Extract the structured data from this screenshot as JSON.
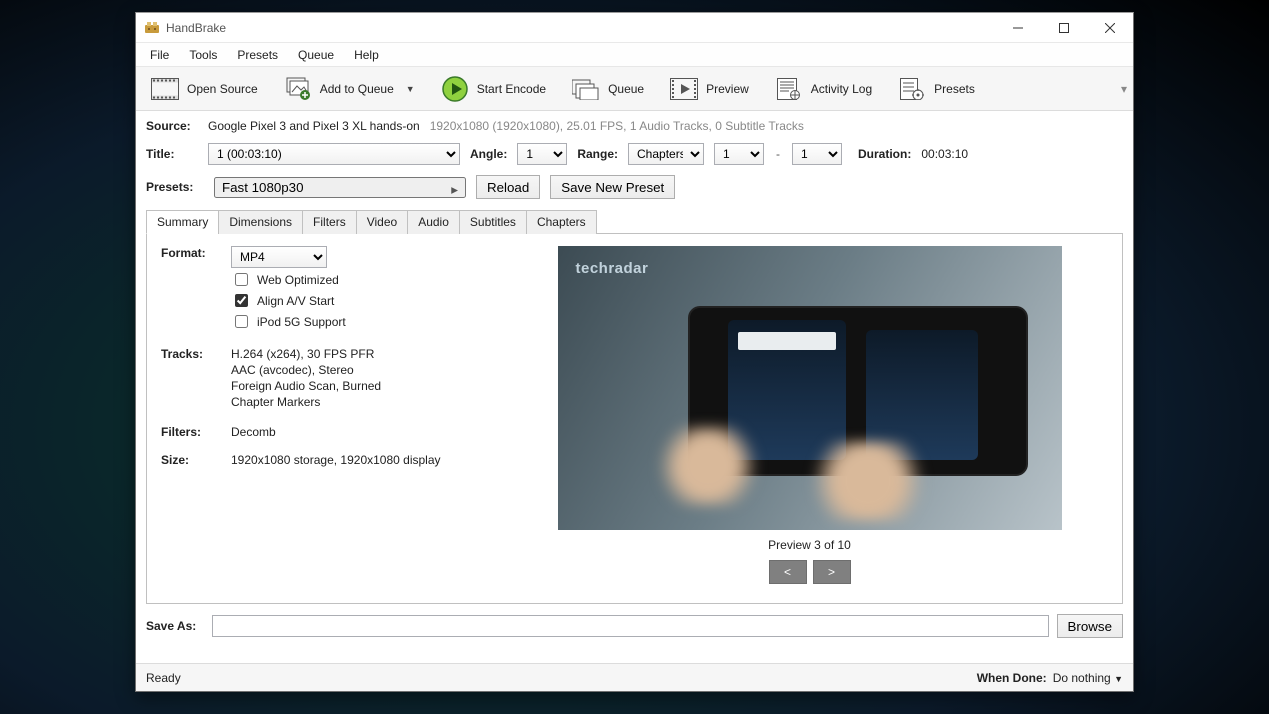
{
  "app": {
    "title": "HandBrake"
  },
  "menubar": {
    "items": [
      "File",
      "Tools",
      "Presets",
      "Queue",
      "Help"
    ]
  },
  "toolbar": {
    "open_source": "Open Source",
    "add_queue": "Add to Queue",
    "start_encode": "Start Encode",
    "queue": "Queue",
    "preview": "Preview",
    "activity_log": "Activity Log",
    "presets": "Presets"
  },
  "source": {
    "label": "Source:",
    "name": "Google Pixel 3 and Pixel 3 XL hands-on",
    "details": "1920x1080 (1920x1080), 25.01 FPS, 1 Audio Tracks, 0 Subtitle Tracks"
  },
  "title_row": {
    "label": "Title:",
    "title_value": "1 (00:03:10)",
    "angle_label": "Angle:",
    "angle_value": "1",
    "range_label": "Range:",
    "range_mode": "Chapters",
    "range_from": "1",
    "range_to": "1",
    "duration_label": "Duration:",
    "duration_value": "00:03:10"
  },
  "presets_row": {
    "label": "Presets:",
    "value": "Fast 1080p30",
    "reload": "Reload",
    "save_new": "Save New Preset"
  },
  "tabs": [
    "Summary",
    "Dimensions",
    "Filters",
    "Video",
    "Audio",
    "Subtitles",
    "Chapters"
  ],
  "summary": {
    "format_label": "Format:",
    "format_value": "MP4",
    "web_optimized": "Web Optimized",
    "align_av": "Align A/V Start",
    "ipod": "iPod 5G Support",
    "tracks_label": "Tracks:",
    "tracks": [
      "H.264 (x264), 30 FPS PFR",
      "AAC (avcodec), Stereo",
      "Foreign Audio Scan, Burned",
      "Chapter Markers"
    ],
    "filters_label": "Filters:",
    "filters_value": "Decomb",
    "size_label": "Size:",
    "size_value": "1920x1080 storage, 1920x1080 display",
    "preview_watermark": "techradar",
    "preview_caption": "Preview 3 of 10",
    "prev": "<",
    "next": ">"
  },
  "saveas": {
    "label": "Save As:",
    "value": "",
    "browse": "Browse"
  },
  "status": {
    "text": "Ready",
    "when_done_label": "When Done:",
    "when_done_value": "Do nothing"
  }
}
